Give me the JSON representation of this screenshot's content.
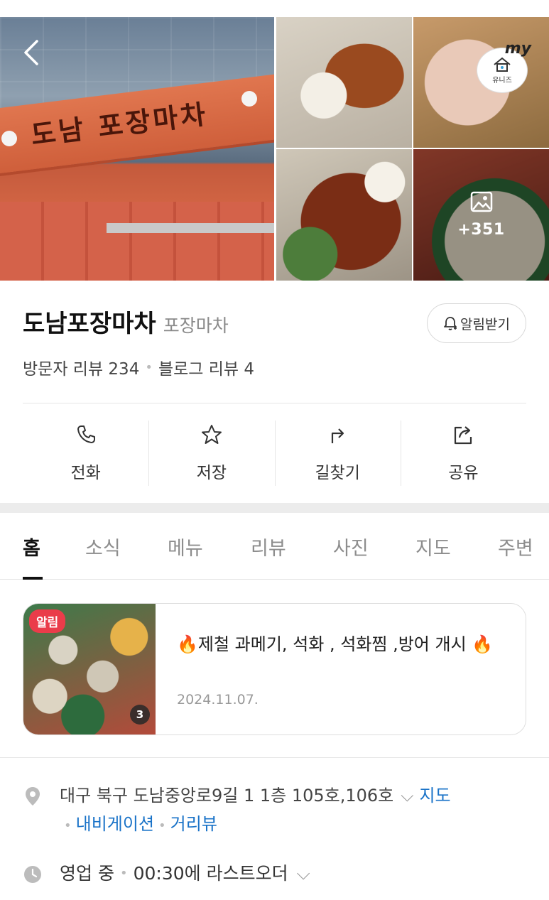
{
  "gallery": {
    "sign_text": "도남 포장마차",
    "more_count": "+351",
    "badge_my": "my",
    "badge_brand": "유니즈"
  },
  "place": {
    "name": "도남포장마차",
    "category": "포장마차",
    "alert_button": "알림받기",
    "visitor_reviews": "방문자 리뷰 234",
    "blog_reviews": "블로그 리뷰 4"
  },
  "actions": [
    {
      "label": "전화",
      "icon": "phone-icon"
    },
    {
      "label": "저장",
      "icon": "star-icon"
    },
    {
      "label": "길찾기",
      "icon": "directions-icon"
    },
    {
      "label": "공유",
      "icon": "share-icon"
    }
  ],
  "tabs": [
    "홈",
    "소식",
    "메뉴",
    "리뷰",
    "사진",
    "지도",
    "주변"
  ],
  "active_tab": "홈",
  "notice": {
    "badge": "알림",
    "image_count": "3",
    "text": "🔥제철 과메기, 석화 , 석화찜 ,방어 개시 🔥",
    "date": "2024.11.07."
  },
  "info": {
    "address": "대구 북구 도남중앙로9길 1 1층 105호,106호",
    "map_link": "지도",
    "navigation_link": "내비게이션",
    "streetview_link": "거리뷰",
    "status": "영업 중",
    "last_order": "00:30에 라스트오더"
  },
  "colors": {
    "link": "#1a73c8",
    "badge_red": "#ea3c4a",
    "sign_orange": "#d86a48"
  }
}
